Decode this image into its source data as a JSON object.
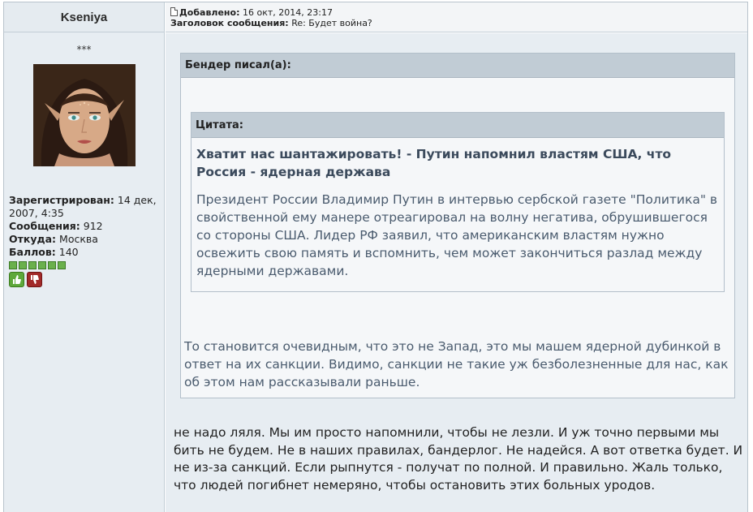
{
  "author": {
    "username": "Kseniya",
    "rank": "***",
    "registered_label": "Зарегистрирован:",
    "registered_value": "14 дек, 2007, 4:35",
    "messages_label": "Сообщения:",
    "messages_value": "912",
    "from_label": "Откуда:",
    "from_value": "Москва",
    "points_label": "Баллов:",
    "points_value": "140",
    "rating_squares": 6
  },
  "post_header": {
    "added_label": "Добавлено:",
    "added_value": "16 окт, 2014, 23:17",
    "subject_label": "Заголовок сообщения:",
    "subject_value": "Re: Будет война?"
  },
  "quote_outer": {
    "title": "Бендер писал(а):",
    "reply_text": "То становится очевидным, что это не Запад, это мы машем ядерной дубинкой в ответ на их санкции. Видимо, санкции не такие уж безболезненные для нас, как об этом нам рассказывали раньше."
  },
  "quote_inner": {
    "title": "Цитата:",
    "headline": "Хватит нас шантажировать! - Путин напомнил властям США, что Россия - ядерная держава",
    "body": "Президент России Владимир Путин в интервью сербской газете \"Политика\" в свойственной ему манере отреагировал на волну негатива, обрушившегося со стороны США. Лидер РФ заявил, что американским властям нужно освежить свою память и вспомнить, чем может закончиться разлад между ядерными державами."
  },
  "message_text": "не надо ляля. Мы им просто напомнили, чтобы не лезли. И уж точно первыми мы бить не будем. Не в наших правилах, бандерлог. Не надейся. А вот ответка будет. И не из-за санкций. Если рыпнутся - получат по полной. И правильно. Жаль только, что людей погибнет немеряно, чтобы остановить этих больных уродов.",
  "icons": {
    "vote_up": "thumbs-up-icon",
    "vote_down": "thumbs-down-icon",
    "post_doc": "document-icon"
  },
  "colors": {
    "panel_bg": "#e7edf2",
    "quote_title_bg": "#c1ccd5",
    "quote_text": "#4a5b6e",
    "rating_green": "#6ab04c",
    "vote_down": "#a22a2a"
  }
}
